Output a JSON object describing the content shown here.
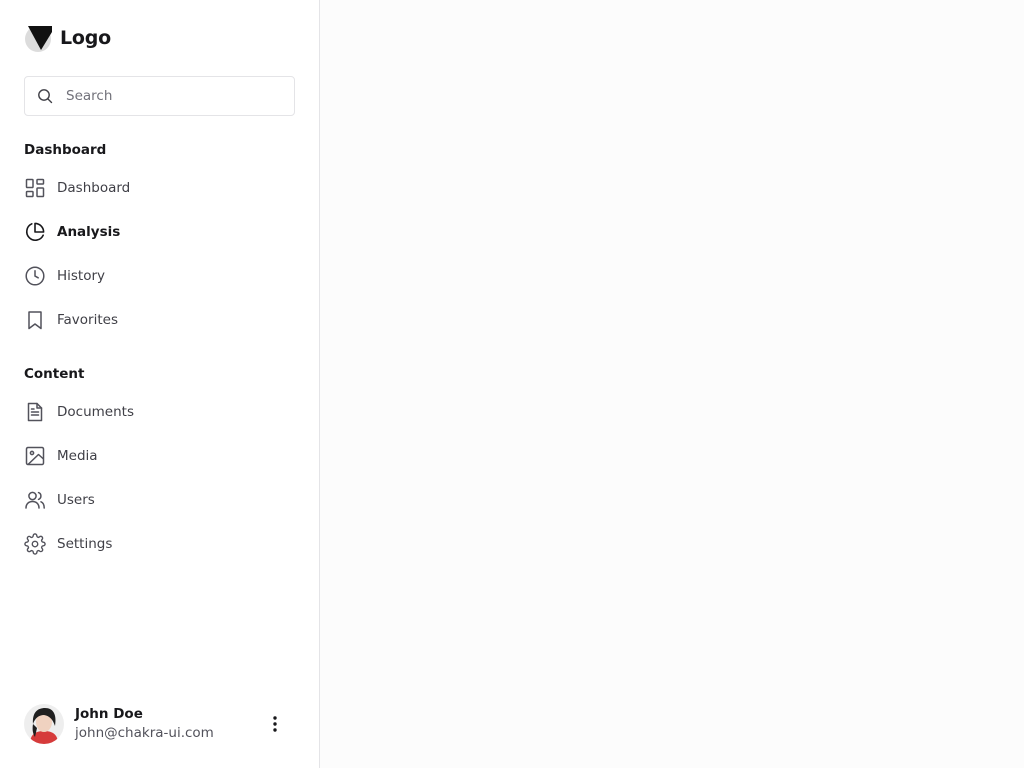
{
  "brand": {
    "logo_text": "Logo"
  },
  "search": {
    "placeholder": "Search",
    "value": ""
  },
  "sections": {
    "dashboard": {
      "heading": "Dashboard",
      "items": [
        {
          "label": "Dashboard",
          "icon": "grid-icon"
        },
        {
          "label": "Analysis",
          "icon": "pie-chart-icon",
          "active": true
        },
        {
          "label": "History",
          "icon": "clock-icon"
        },
        {
          "label": "Favorites",
          "icon": "bookmark-icon"
        }
      ]
    },
    "content": {
      "heading": "Content",
      "items": [
        {
          "label": "Documents",
          "icon": "file-text-icon"
        },
        {
          "label": "Media",
          "icon": "image-icon"
        },
        {
          "label": "Users",
          "icon": "users-icon"
        },
        {
          "label": "Settings",
          "icon": "gear-icon"
        }
      ]
    }
  },
  "user": {
    "name": "John Doe",
    "email": "john@chakra-ui.com",
    "menu_icon": "more-vertical-icon"
  },
  "colors": {
    "sidebar_bg": "#ffffff",
    "main_bg": "#fcfcfc",
    "border": "#e4e4e7",
    "text": "#18181b",
    "muted_text": "#3f3f46"
  }
}
